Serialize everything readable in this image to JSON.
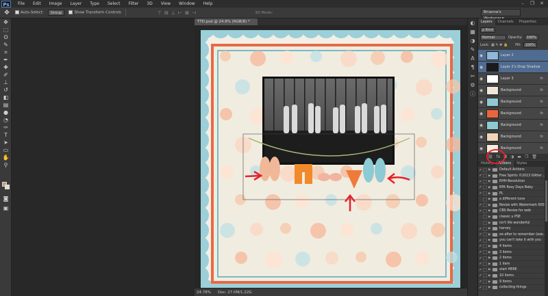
{
  "menubar": {
    "logo": "Ps",
    "items": [
      "File",
      "Edit",
      "Image",
      "Layer",
      "Type",
      "Select",
      "Filter",
      "3D",
      "View",
      "Window",
      "Help"
    ],
    "window_controls": [
      "–",
      "❐",
      "✕"
    ]
  },
  "options_bar": {
    "auto_select_label": "Auto-Select:",
    "auto_select_value": "Group",
    "show_transform_label": "Show Transform Controls",
    "mode_3d_label": "3D Mode:",
    "workspace": "Brianna's Workspace"
  },
  "document": {
    "tab_title": "TTD.psd @ 24.8% (RGB/8) *",
    "zoom": "24.78%",
    "doc_size": "Doc: 27.0M/1.22G"
  },
  "colors": {
    "foreground": "#c79a74",
    "background": "#e8dcc8",
    "accent_orange": "#e66a45",
    "accent_teal": "#9ccfd8",
    "annotation_red": "#e8202a",
    "selected_layer": "#4f6b8f"
  },
  "layers_panel": {
    "tabs": [
      "Layers",
      "Channels",
      "Properties"
    ],
    "kind_filter": "ρ Kind",
    "blend_mode": "Normal",
    "opacity_label": "Opacity:",
    "opacity_value": "100%",
    "lock_label": "Lock:",
    "fill_label": "Fill:",
    "fill_value": "100%",
    "layers": [
      {
        "name": "Layer 2",
        "selected": true,
        "fx": false,
        "thumb": "#8fb8d8"
      },
      {
        "name": "Layer 2's Drop Shadow",
        "selected": true,
        "fx": false,
        "thumb": "#1a1a1a"
      },
      {
        "name": "Layer 3",
        "selected": false,
        "fx": true,
        "thumb": "#ffffff"
      },
      {
        "name": "Background",
        "selected": false,
        "fx": true,
        "thumb": "#f0e6d8"
      },
      {
        "name": "Background",
        "selected": false,
        "fx": true,
        "thumb": "#8ec9d2"
      },
      {
        "name": "Background",
        "selected": false,
        "fx": true,
        "thumb": "#e8663e"
      },
      {
        "name": "Background",
        "selected": false,
        "fx": true,
        "thumb": "#8ec9d2"
      },
      {
        "name": "Background",
        "selected": false,
        "fx": true,
        "thumb": "#f2d5b8"
      },
      {
        "name": "Background",
        "selected": false,
        "fx": true,
        "thumb": "#f4ede0"
      }
    ],
    "footer_icons": [
      "link-icon",
      "fx-icon",
      "mask-icon",
      "adjustment-icon",
      "folder-icon",
      "new-layer-icon",
      "trash-icon"
    ]
  },
  "actions_panel": {
    "tabs": [
      "History",
      "Actions",
      "Styles"
    ],
    "items": [
      {
        "label": "Default Actions",
        "enabled": true
      },
      {
        "label": "Free Spirits ©2013 Glitter ...",
        "enabled": true
      },
      {
        "label": "RHH-Resolution",
        "enabled": true
      },
      {
        "label": "RFA Rosy Days Baby",
        "enabled": true
      },
      {
        "label": "PL",
        "enabled": true
      },
      {
        "label": "a different tune",
        "enabled": false
      },
      {
        "label": "Resize with Watermark 600...",
        "enabled": true
      },
      {
        "label": "CBS Resize for web",
        "enabled": true
      },
      {
        "label": "classic u PSE",
        "enabled": false
      },
      {
        "label": "isn't life wonderful",
        "enabled": false
      },
      {
        "label": "harvey",
        "enabled": true
      },
      {
        "label": "ee after to remember (exe...",
        "enabled": true
      },
      {
        "label": "you can't take it with you",
        "enabled": true
      },
      {
        "label": "4 items",
        "enabled": true
      },
      {
        "label": "3 items",
        "enabled": true
      },
      {
        "label": "2 items",
        "enabled": true
      },
      {
        "label": "1 item",
        "enabled": true
      },
      {
        "label": "start HERE",
        "enabled": true
      },
      {
        "label": "10 items",
        "enabled": true
      },
      {
        "label": "9 items",
        "enabled": true
      },
      {
        "label": "collecting things",
        "enabled": true
      }
    ]
  },
  "toolbar": {
    "tools": [
      "move-icon",
      "marquee-icon",
      "lasso-icon",
      "quick-select-icon",
      "crop-icon",
      "eyedropper-icon",
      "healing-icon",
      "brush-icon",
      "stamp-icon",
      "history-brush-icon",
      "eraser-icon",
      "gradient-icon",
      "blur-icon",
      "dodge-icon",
      "pen-icon",
      "type-icon",
      "path-select-icon",
      "shape-icon",
      "hand-icon",
      "zoom-icon"
    ]
  }
}
